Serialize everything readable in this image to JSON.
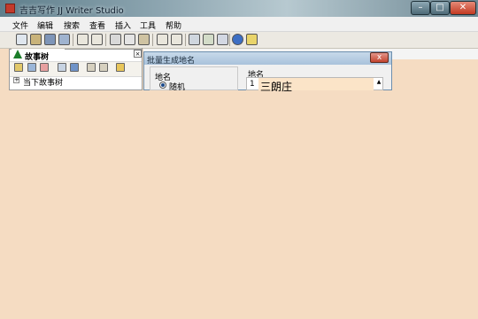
{
  "window": {
    "title": "吉吉写作 JJ Writer Studio",
    "min_label": "–",
    "max_label": "□",
    "close_label": "✕"
  },
  "menu": {
    "items": [
      "文件",
      "编辑",
      "搜索",
      "查看",
      "插入",
      "工具",
      "帮助"
    ]
  },
  "toolbar": {
    "icons": [
      "new-icon",
      "open-icon",
      "save-icon",
      "save-all-icon",
      "undo-icon",
      "redo-icon",
      "cut-icon",
      "copy-icon",
      "paste-icon",
      "indent-icon",
      "outdent-icon",
      "find-icon",
      "replace-icon",
      "find-next-icon",
      "help-icon",
      "info-icon"
    ]
  },
  "story_panel": {
    "title": "故事树",
    "close_label": "×",
    "tools": [
      "add-folder-icon",
      "add-doc-icon",
      "delete-icon",
      "move-up-icon",
      "properties-icon",
      "prev-icon",
      "next-icon",
      "lock-icon"
    ],
    "tree": {
      "expander": "+",
      "root_label": "当下故事树"
    }
  },
  "dialog": {
    "title": "批量生成地名",
    "close_label": "x",
    "group_label": "地名",
    "radio_label": "随机",
    "list_header": "地名",
    "rows": [
      {
        "number": "1",
        "value": "三朗庄"
      }
    ],
    "scroll_up": "▲"
  },
  "colors": {
    "overlay": "#f5dcc2",
    "selection": "#fbe4c8",
    "dialog_close": "#c2432e"
  }
}
